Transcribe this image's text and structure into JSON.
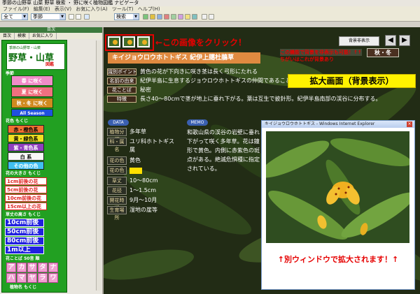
{
  "window": {
    "title": "季節の山野草 山菜 野草 検索 ・ 野に咲く植物図鑑 ナビゲータ"
  },
  "menu": [
    "ファイル(F)",
    "編集(E)",
    "表示(V)",
    "お気に入り(A)",
    "ツール(T)",
    "ヘルプ(H)"
  ],
  "toolbar": {
    "combo1": "全て",
    "combo2": "季節",
    "combo3": "検索"
  },
  "left": {
    "header": "目次",
    "tabs": [
      "目次",
      "検索",
      "お気に入り"
    ],
    "logo": {
      "small": "季節の山野草・山菜",
      "big": "野草・山草",
      "badge": "図鑑"
    },
    "seasons_label": "季節",
    "seasons": [
      {
        "label": "春 に咲く",
        "sub": "野草・山草",
        "color": "#f08cc8"
      },
      {
        "label": "夏 に咲く",
        "sub": "野草・山草",
        "color": "#f07080"
      },
      {
        "label": "秋・冬 に咲く",
        "sub": "野草・山草",
        "color": "#d08a20"
      }
    ],
    "all_season": "All Season",
    "colors_label": "花色 もくじ",
    "colors": [
      {
        "label": "赤・橙色系",
        "color": "#f07030"
      },
      {
        "label": "黄・緑色系",
        "color": "#f0e020"
      },
      {
        "label": "紫・青色系",
        "color": "#9040c0"
      },
      {
        "label": "白 系",
        "color": "#f8f8f8"
      },
      {
        "label": "その他の色",
        "color": "#40c0f0"
      }
    ],
    "height_label": "花の大きさ もくじ",
    "height_items": [
      "1cm前後の花",
      "5cm前後の花",
      "10cm前後の花",
      "15cm以上の花"
    ],
    "width_label": "草丈の高さ もくじ",
    "width_items": [
      "10cm前後",
      "50cm前後",
      "80cm前後",
      "1m以上"
    ],
    "kana_label": "花ことば 50音 順",
    "kana": [
      "ア",
      "カ",
      "サ",
      "タ",
      "ナ",
      "ハ",
      "マ",
      "ヤ",
      "ラ",
      "ワ"
    ],
    "footer": "植物名 もくじ"
  },
  "main": {
    "click_annotation": "←この画像をクリック！",
    "overlay_note": "この機能で背景を非表示も可能！↑↑",
    "overlay_note2": "ちがいはこれが背景あり",
    "season_badge": "秋・冬",
    "plant_name": "キイジョウロウホトトギス 紀伊上臈杜鵑草",
    "big_annotation": "拡大画面（背景表示）",
    "rows": [
      {
        "label": "識別ポイント",
        "value": "黄色の花が下向きに咲き茎は長く弓形にたれる"
      },
      {
        "label": "名前の由来",
        "value": "紀伊半島に生息するジョウロウホトトギスの仲間であることから"
      },
      {
        "label": "花ことば",
        "value": "秘密"
      },
      {
        "label": "特徴",
        "value": "長さ40〜80cmで茎が地上に垂れ下がる。葉は互生で披針形。紀伊半島南部の渓谷に分布する。"
      }
    ],
    "data_label": "DATA",
    "memo_label": "MEMO",
    "data_rows": [
      {
        "label": "植物分類",
        "value": "多年草"
      },
      {
        "label": "科・属名",
        "value": "ユリ科ホトトギス属"
      },
      {
        "label": "花の色",
        "value": "黄色"
      },
      {
        "label": "花の色",
        "value": ""
      },
      {
        "label": "草丈",
        "value": "10〜80cm"
      },
      {
        "label": "花径",
        "value": "1〜1.5cm"
      },
      {
        "label": "開花時期",
        "value": "9月〜10月"
      },
      {
        "label": "生育場所",
        "value": "湿地の崖等"
      }
    ],
    "memo_text": "和歌山県の渓谷の岩壁に垂れ下がって咲く多年草。花は鐘形で黄色。内側に赤紫色の斑点がある。絶滅危惧種に指定されている。"
  },
  "popup": {
    "title": "キイジョウロウホトトギス - Windows Internet Explorer",
    "caption": "↑別ウィンドウで拡大されます！↑"
  }
}
